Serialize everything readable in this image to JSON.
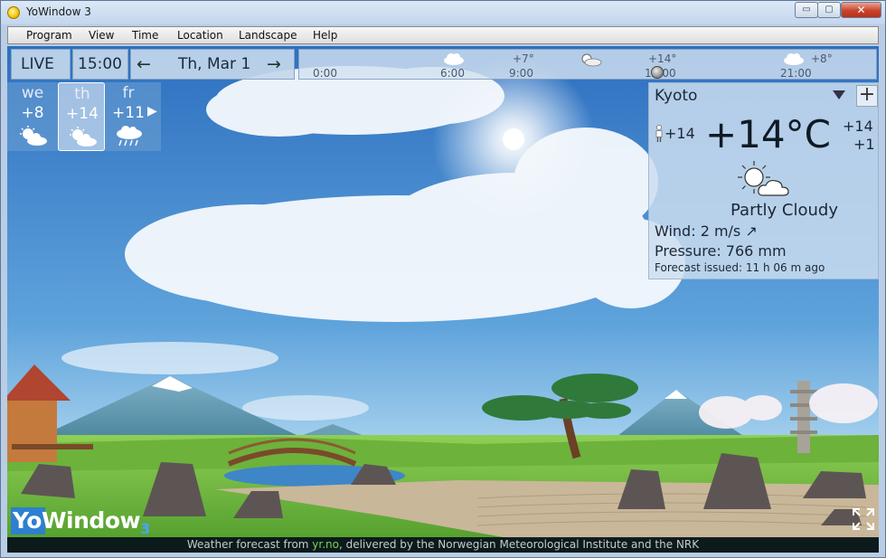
{
  "window": {
    "title": "YoWindow 3"
  },
  "window_controls": {
    "minimize": "▭",
    "maximize": "▢",
    "close": "✕"
  },
  "menu": {
    "items": [
      "Program",
      "View",
      "Time",
      "Location",
      "Landscape",
      "Help"
    ]
  },
  "controls": {
    "live": "LIVE",
    "time": "15:00",
    "date": "Th, Mar 1",
    "prev_arrow": "←",
    "next_arrow": "→"
  },
  "timeline": {
    "hours": [
      "0:00",
      "6:00",
      "9:00",
      "12:00",
      "21:00"
    ],
    "temps": [
      "+7°",
      "+14°",
      "+8°"
    ],
    "current_position": 0.62
  },
  "days": [
    {
      "name": "we",
      "temp": "+8",
      "icon": "partly-cloudy-icon"
    },
    {
      "name": "th",
      "temp": "+14",
      "icon": "partly-cloudy-icon",
      "selected": true
    },
    {
      "name": "fr",
      "temp": "+11",
      "icon": "rain-cloud-icon"
    }
  ],
  "days_more_arrow": "▶",
  "weather": {
    "city": "Kyoto",
    "add_label": "+",
    "feels_like": "+14",
    "temperature": "+14°C",
    "high": "+14",
    "low": "+1",
    "condition": "Partly Cloudy",
    "wind": "Wind:  2 m/s ↗",
    "pressure": "Pressure:  766 mm",
    "forecast_issued": "Forecast issued:  11 h 06 m ago"
  },
  "footer": {
    "prefix": "Weather forecast from ",
    "link": "yr.no",
    "suffix": ", delivered by the Norwegian Meteorological Institute and the NRK"
  },
  "logo": {
    "text_main": "YoWindow",
    "text_sub": "3"
  },
  "colors": {
    "sky_top": "#2f71c0",
    "sky_bottom": "#9ccbea",
    "grass": "#7fbf3f",
    "accent_green": "#7bd35a"
  }
}
